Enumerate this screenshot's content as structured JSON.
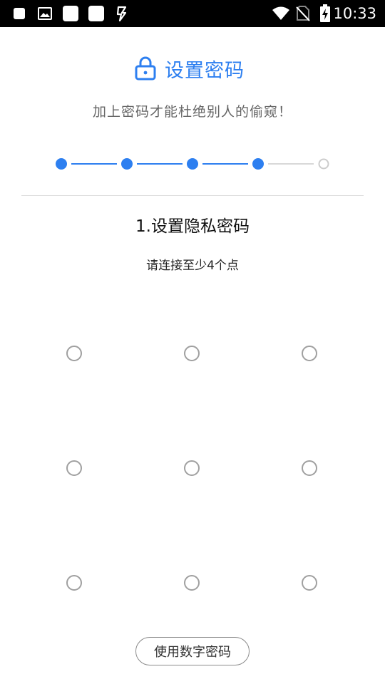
{
  "status_bar": {
    "time": "10:33",
    "icons": [
      "notification-square-icon",
      "gallery-icon",
      "notification-square-icon",
      "notification-square-icon",
      "lightning-app-icon",
      "wifi-icon",
      "no-sim-icon",
      "battery-charging-icon"
    ]
  },
  "header": {
    "title": "设置密码",
    "subtitle": "加上密码才能杜绝别人的偷窥！",
    "accent_color": "#2d7ff0"
  },
  "stepper": {
    "total_steps": 5,
    "completed_steps": 4,
    "active_color": "#2d7ff0",
    "inactive_color": "#cccccc"
  },
  "step": {
    "title": "1.设置隐私密码",
    "hint": "请连接至少4个点"
  },
  "pattern": {
    "rows": 3,
    "cols": 3
  },
  "footer": {
    "numeric_button_label": "使用数字密码"
  }
}
